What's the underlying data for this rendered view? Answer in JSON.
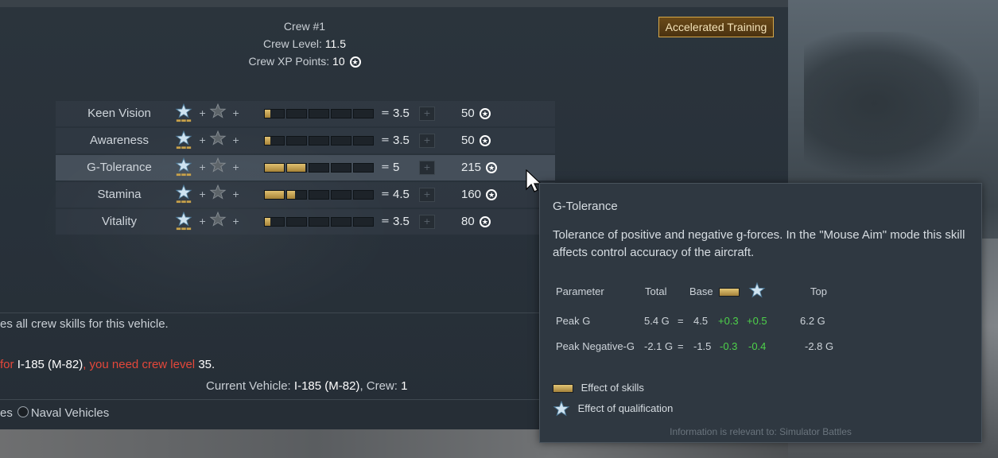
{
  "crew": {
    "title": "Crew #1",
    "level_label": "Crew Level:",
    "level_value": "11.5",
    "xp_label": "Crew XP Points:",
    "xp_value": "10"
  },
  "accelerated_training_label": "Accelerated Training",
  "skills": [
    {
      "name": "Keen Vision",
      "value": "3.5",
      "cost": "50",
      "bar_fill": [
        0.3,
        0,
        0,
        0,
        0
      ]
    },
    {
      "name": "Awareness",
      "value": "3.5",
      "cost": "50",
      "bar_fill": [
        0.3,
        0,
        0,
        0,
        0
      ]
    },
    {
      "name": "G-Tolerance",
      "value": "5",
      "cost": "215",
      "bar_fill": [
        1,
        0.95,
        0,
        0,
        0
      ]
    },
    {
      "name": "Stamina",
      "value": "4.5",
      "cost": "160",
      "bar_fill": [
        1,
        0.4,
        0,
        0,
        0
      ]
    },
    {
      "name": "Vitality",
      "value": "3.5",
      "cost": "80",
      "bar_fill": [
        0.3,
        0,
        0,
        0,
        0
      ]
    }
  ],
  "skill_row_symbols": {
    "plus": "+",
    "equals": "=",
    "increase": "+"
  },
  "info": {
    "line1": "es all crew skills for this vehicle.",
    "line2_prefix": "for",
    "line2_vehicle": "I-185 (M-82)",
    "line2_middle": ", you need crew level",
    "line2_level": "35",
    "line2_end": ".",
    "current_vehicle_label": "Current Vehicle:",
    "current_vehicle_value": "I-185 (M-82)",
    "crew_label": ", Crew:",
    "crew_value": "1",
    "filter_prev_tail": "es",
    "filter_naval": "Naval Vehicles"
  },
  "tooltip": {
    "title": "G-Tolerance",
    "description": "Tolerance of positive and negative g-forces. In the \"Mouse Aim\" mode this skill affects control accuracy of the aircraft.",
    "headers": {
      "parameter": "Parameter",
      "total": "Total",
      "base": "Base",
      "top": "Top"
    },
    "rows": [
      {
        "parameter": "Peak G",
        "total": "5.4 G",
        "eq": "=",
        "base": "4.5",
        "skills": "+0.3",
        "qual": "+0.5",
        "top": "6.2 G"
      },
      {
        "parameter": "Peak Negative-G",
        "total": "-2.1 G",
        "eq": "=",
        "base": "-1.5",
        "skills": "-0.3",
        "qual": "-0.4",
        "top": "-2.8 G"
      }
    ],
    "legend_skills": "Effect of skills",
    "legend_qualification": "Effect of qualification",
    "footer": "Information is relevant to: Simulator Battles"
  },
  "colors": {
    "accent_gold": "#d6a84a",
    "red": "#e4473a",
    "green": "#4ed24a"
  },
  "icons": {
    "rank": "silver-rank-star-icon",
    "rank_locked": "gray-rank-star-icon",
    "coin": "crew-xp-star-icon",
    "cursor": "mouse-cursor-icon"
  }
}
